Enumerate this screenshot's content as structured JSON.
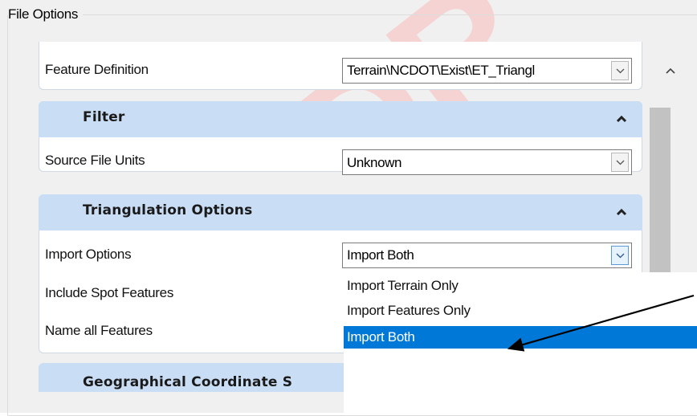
{
  "group_label": "File Options",
  "watermark_text": "DR",
  "feature_definition": {
    "label": "Feature Definition",
    "value": "Terrain\\NCDOT\\Exist\\ET_Triangl"
  },
  "sections": {
    "filter": {
      "title": "Filter",
      "source_file_units": {
        "label": "Source File Units",
        "value": "Unknown"
      }
    },
    "triangulation": {
      "title": "Triangulation Options",
      "import_options": {
        "label": "Import Options",
        "value": "Import Both"
      },
      "include_spot_features_label": "Include Spot Features",
      "name_all_features_label": "Name all Features"
    },
    "geographical": {
      "title": "Geographical Coordinate S"
    }
  },
  "dropdown": {
    "options": [
      "Import Terrain Only",
      "Import Features Only",
      "Import Both"
    ],
    "selected": "Import Both"
  },
  "colors": {
    "section_header": "#c9ddf5",
    "selected_item": "#0078d7",
    "annotation_arrow": "#000000",
    "watermark": "#f3c9c9"
  },
  "icons": {
    "collapse": "chevron-up-icon",
    "combo": "chevron-down-icon",
    "scroll_up": "scroll-up-icon"
  }
}
